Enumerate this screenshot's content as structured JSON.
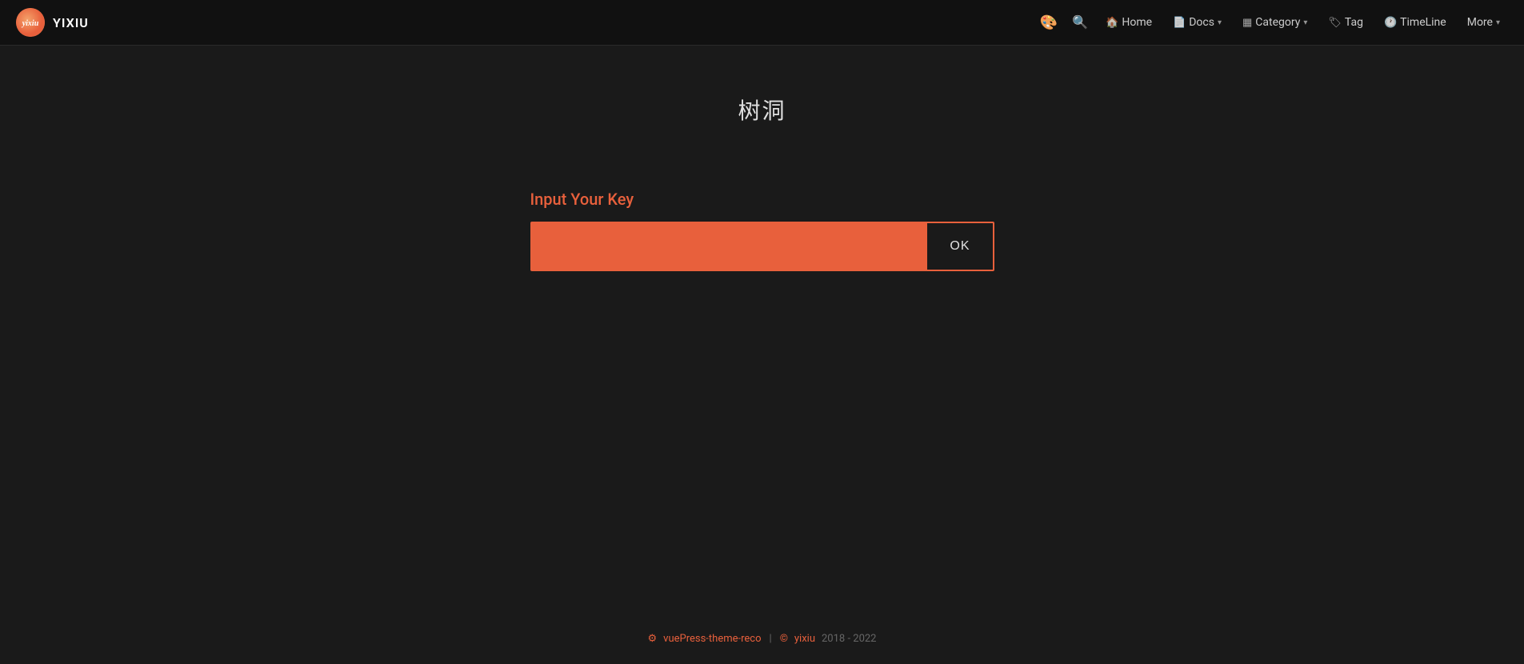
{
  "app": {
    "title": "YIXIU"
  },
  "navbar": {
    "logo_text": "YIXIU",
    "paint_icon": "🎨",
    "search_icon": "🔍",
    "nav_items": [
      {
        "label": "Home",
        "icon": "🏠",
        "has_dropdown": false
      },
      {
        "label": "Docs",
        "icon": "📄",
        "has_dropdown": true
      },
      {
        "label": "Category",
        "icon": "▦",
        "has_dropdown": true
      },
      {
        "label": "Tag",
        "icon": "🏷",
        "has_dropdown": false
      },
      {
        "label": "TimeLine",
        "icon": "🕐",
        "has_dropdown": false
      },
      {
        "label": "More",
        "icon": "",
        "has_dropdown": true
      }
    ]
  },
  "main": {
    "page_title": "树洞",
    "key_label": "Input Your Key",
    "key_placeholder": "",
    "ok_button_label": "OK"
  },
  "footer": {
    "theme_icon": "⚙",
    "theme_text": "vuePress-theme-reco",
    "author_icon": "©",
    "author_text": "yixiu",
    "year_text": "2018 - 2022"
  },
  "colors": {
    "accent": "#e8603c",
    "bg": "#1a1a1a",
    "navbar_bg": "#111111",
    "text": "#cccccc"
  }
}
